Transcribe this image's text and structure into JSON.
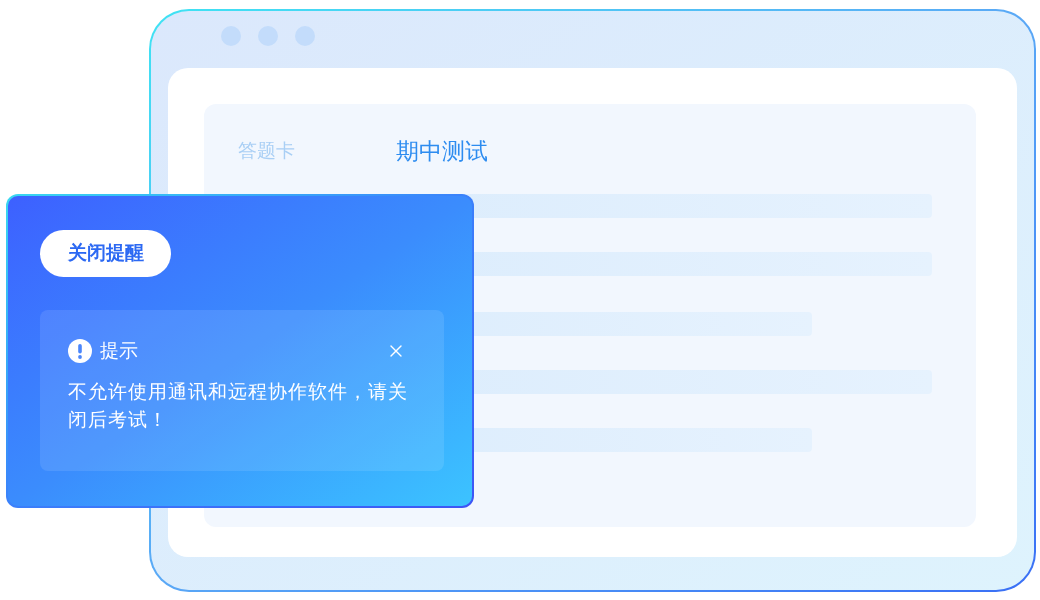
{
  "answer_sheet": {
    "tab_label": "答题卡",
    "title": "期中测试"
  },
  "reminder": {
    "button": "关闭提醒",
    "notice": {
      "title": "提示",
      "message": "不允许使用通讯和远程协作软件，请关闭后考试！"
    }
  }
}
